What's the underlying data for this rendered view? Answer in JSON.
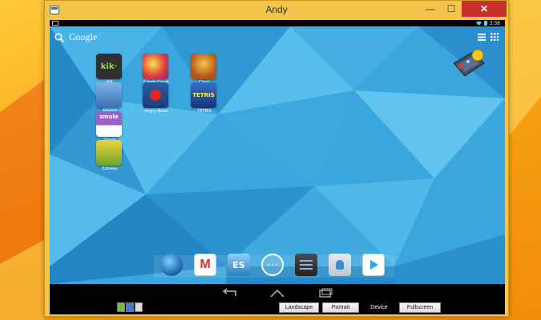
{
  "window": {
    "title": "Andy",
    "minimize_glyph": "—",
    "maximize_glyph": "☐",
    "close_glyph": "✕",
    "app_icon": "window-app-icon"
  },
  "android": {
    "status_time": "3:38",
    "search_label": "Google",
    "home_apps": [
      {
        "label": "Kik",
        "icon": "kik-icon",
        "color": "#3a3a3a",
        "badge": "kik·"
      },
      {
        "label": "Candy Crush",
        "icon": "candy-crush-icon",
        "color": "#c8382f",
        "badge": ""
      },
      {
        "label": "Clash",
        "icon": "clash-icon",
        "color": "#d8941a",
        "badge": ""
      },
      {
        "label": "Jetpack",
        "icon": "jetpack-icon",
        "color": "#5b8fd0",
        "badge": ""
      },
      {
        "label": "Angry Birds",
        "icon": "angry-birds-icon",
        "color": "#2f5fa8",
        "badge": ""
      },
      {
        "label": "TETRIS",
        "icon": "tetris-icon",
        "color": "#2c59a8",
        "badge": "TETRIS"
      },
      {
        "label": "Smule",
        "icon": "smule-piano-icon",
        "color": "#8a54b8",
        "badge": "smule"
      },
      {
        "label": "Subway",
        "icon": "subway-surfers-icon",
        "color": "#6aa62e",
        "badge": ""
      }
    ],
    "dock": [
      "globe-browser-icon",
      "gmail-icon",
      "es-file-explorer-icon",
      "app-drawer-icon",
      "settings-icon",
      "contacts-icon",
      "play-store-icon"
    ]
  },
  "bottom": {
    "modes": [
      "Landscape",
      "Portrait",
      "Device",
      "Fullscreen"
    ],
    "selected_mode": "Device"
  }
}
